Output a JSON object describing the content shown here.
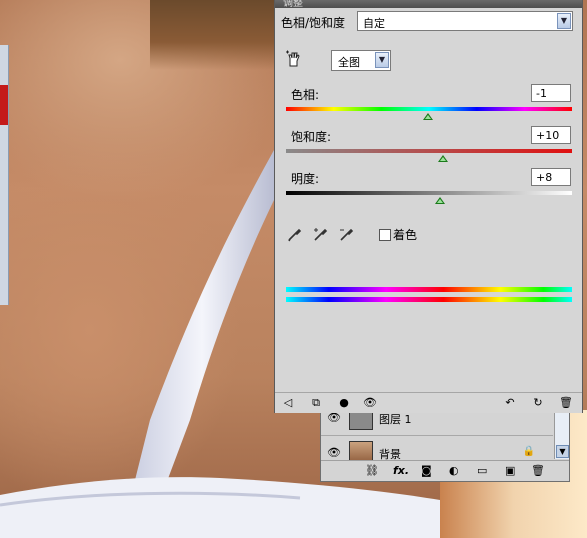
{
  "panel": {
    "title": "调整",
    "preset_label": "色相/饱和度",
    "preset_value": "自定",
    "range_value": "全图",
    "hue": {
      "label": "色相:",
      "value": "-1",
      "position": 0.495
    },
    "saturation": {
      "label": "饱和度:",
      "value": "+10",
      "position": 0.55
    },
    "lightness": {
      "label": "明度:",
      "value": "+8",
      "position": 0.54
    },
    "colorize_label": "着色"
  },
  "layers": {
    "rows": [
      {
        "name": "图层 1"
      },
      {
        "name": "背景"
      }
    ],
    "bar_icons": [
      "link-icon",
      "fx-icon",
      "mask-icon",
      "adjustment-icon",
      "folder-icon",
      "new-layer-icon",
      "trash-icon"
    ]
  },
  "colors": {
    "panel_bg": "#d6d6d6",
    "thumb_green": "#1a7a1a"
  }
}
